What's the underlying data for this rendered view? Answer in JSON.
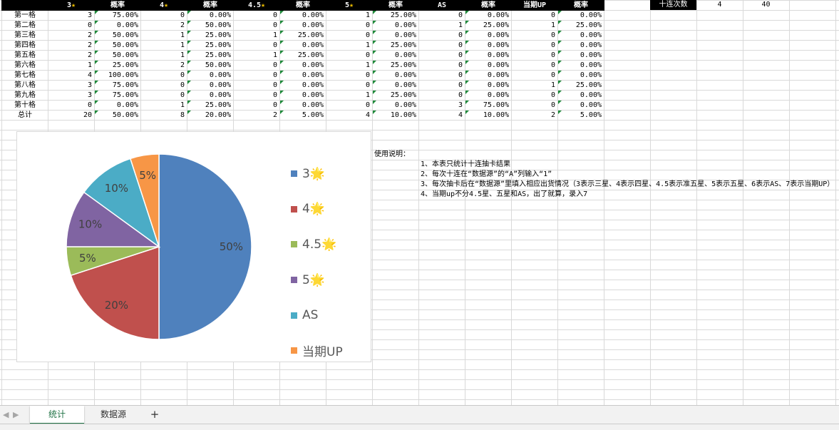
{
  "sheet": {
    "headers": [
      "",
      "3",
      "概率",
      "4",
      "概率",
      "4.5",
      "概率",
      "5",
      "概率",
      "AS",
      "概率",
      "当期UP",
      "概率"
    ],
    "star_headers": [
      1,
      3,
      5,
      7
    ],
    "rows": [
      [
        "第一格",
        "3",
        "75.00%",
        "0",
        "0.00%",
        "0",
        "0.00%",
        "1",
        "25.00%",
        "0",
        "0.00%",
        "0",
        "0.00%"
      ],
      [
        "第二格",
        "0",
        "0.00%",
        "2",
        "50.00%",
        "0",
        "0.00%",
        "0",
        "0.00%",
        "1",
        "25.00%",
        "1",
        "25.00%"
      ],
      [
        "第三格",
        "2",
        "50.00%",
        "1",
        "25.00%",
        "1",
        "25.00%",
        "0",
        "0.00%",
        "0",
        "0.00%",
        "0",
        "0.00%"
      ],
      [
        "第四格",
        "2",
        "50.00%",
        "1",
        "25.00%",
        "0",
        "0.00%",
        "1",
        "25.00%",
        "0",
        "0.00%",
        "0",
        "0.00%"
      ],
      [
        "第五格",
        "2",
        "50.00%",
        "1",
        "25.00%",
        "1",
        "25.00%",
        "0",
        "0.00%",
        "0",
        "0.00%",
        "0",
        "0.00%"
      ],
      [
        "第六格",
        "1",
        "25.00%",
        "2",
        "50.00%",
        "0",
        "0.00%",
        "1",
        "25.00%",
        "0",
        "0.00%",
        "0",
        "0.00%"
      ],
      [
        "第七格",
        "4",
        "100.00%",
        "0",
        "0.00%",
        "0",
        "0.00%",
        "0",
        "0.00%",
        "0",
        "0.00%",
        "0",
        "0.00%"
      ],
      [
        "第八格",
        "3",
        "75.00%",
        "0",
        "0.00%",
        "0",
        "0.00%",
        "0",
        "0.00%",
        "0",
        "0.00%",
        "1",
        "25.00%"
      ],
      [
        "第九格",
        "3",
        "75.00%",
        "0",
        "0.00%",
        "0",
        "0.00%",
        "1",
        "25.00%",
        "0",
        "0.00%",
        "0",
        "0.00%"
      ],
      [
        "第十格",
        "0",
        "0.00%",
        "1",
        "25.00%",
        "0",
        "0.00%",
        "0",
        "0.00%",
        "3",
        "75.00%",
        "0",
        "0.00%"
      ],
      [
        "总计",
        "20",
        "50.00%",
        "8",
        "20.00%",
        "2",
        "5.00%",
        "4",
        "10.00%",
        "4",
        "10.00%",
        "2",
        "5.00%"
      ]
    ],
    "ten_pull": {
      "label": "十连次数",
      "count": "4",
      "total": "40"
    }
  },
  "chart_data": {
    "type": "pie",
    "categories": [
      "3🌟",
      "4🌟",
      "4.5🌟",
      "5🌟",
      "AS",
      "当期UP"
    ],
    "values": [
      50,
      20,
      5,
      10,
      10,
      5
    ],
    "labels": [
      "50%",
      "20%",
      "5%",
      "10%",
      "10%",
      "5%"
    ],
    "colors": [
      "#4f81bd",
      "#c0504d",
      "#9bbb59",
      "#8064a2",
      "#4bacc6",
      "#f79646"
    ],
    "legend": "right"
  },
  "notes": {
    "title": "使用说明：",
    "lines": [
      "1、本表只统计十连抽卡结果",
      "2、每次十连在“数据源”的“A”列输入“1”",
      "3、每次抽卡后在“数据源”里填入相应出货情况（3表示三星、4表示四星、4.5表示准五星、5表示五星、6表示AS、7表示当期UP）",
      "4、当期up不分4.5星、五星和AS，出了就算，录入7"
    ]
  },
  "tabs": {
    "items": [
      "统计",
      "数据源"
    ],
    "add": "+",
    "active": 0
  },
  "icons": {
    "star": "star-icon",
    "add": "plus-icon"
  }
}
